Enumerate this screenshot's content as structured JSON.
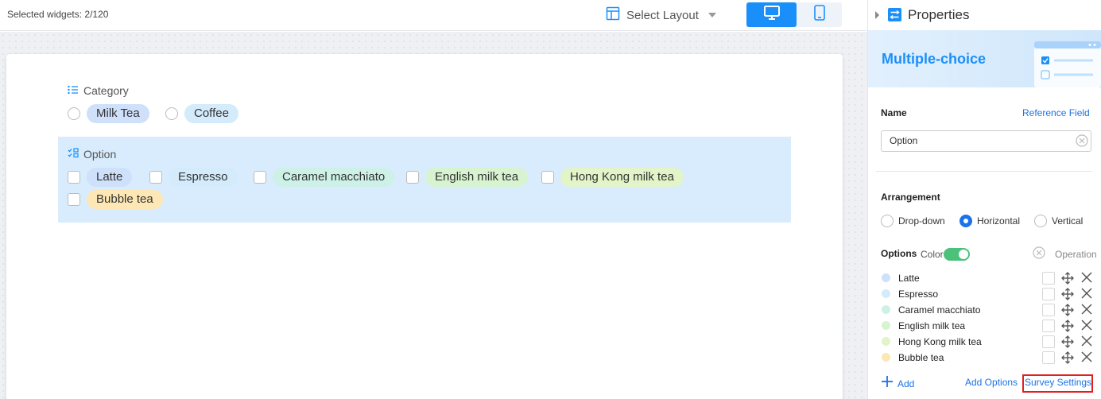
{
  "toolbar": {
    "selected_count": "Selected widgets: 2/120",
    "layout_label": "Select Layout",
    "accent": "#1a8ffa"
  },
  "form": {
    "category": {
      "label": "Category",
      "options": [
        {
          "label": "Milk Tea",
          "color": "#cfe0fb"
        },
        {
          "label": "Coffee",
          "color": "#d3ebfb"
        }
      ]
    },
    "option": {
      "label": "Option",
      "options": [
        {
          "label": "Latte",
          "color": "#cfe0fb"
        },
        {
          "label": "Espresso",
          "color": "#d3ebfb"
        },
        {
          "label": "Caramel macchiato",
          "color": "#cdf1e6"
        },
        {
          "label": "English milk tea",
          "color": "#d7f3d0"
        },
        {
          "label": "Hong Kong milk tea",
          "color": "#e2f4c8"
        },
        {
          "label": "Bubble tea",
          "color": "#fde7b5"
        }
      ]
    }
  },
  "panel": {
    "title": "Properties",
    "widget_type": "Multiple-choice",
    "name_label": "Name",
    "reference_field": "Reference Field",
    "name_value": "Option",
    "arrangement_label": "Arrangement",
    "arrangement_options": [
      "Drop-down",
      "Horizontal",
      "Vertical"
    ],
    "arrangement_selected": "Horizontal",
    "options_label": "Options",
    "color_label": "Color",
    "color_enabled": true,
    "operation_label": "Operation",
    "options": [
      {
        "label": "Latte",
        "color": "#cfe0fb"
      },
      {
        "label": "Espresso",
        "color": "#d3ebfb"
      },
      {
        "label": "Caramel macchiato",
        "color": "#cdf1e6"
      },
      {
        "label": "English milk tea",
        "color": "#d7f3d0"
      },
      {
        "label": "Hong Kong milk tea",
        "color": "#e2f4c8"
      },
      {
        "label": "Bubble tea",
        "color": "#fde7b5"
      }
    ],
    "add_label": "Add",
    "add_options_label": "Add Options",
    "survey_settings_label": "Survey Settings"
  }
}
